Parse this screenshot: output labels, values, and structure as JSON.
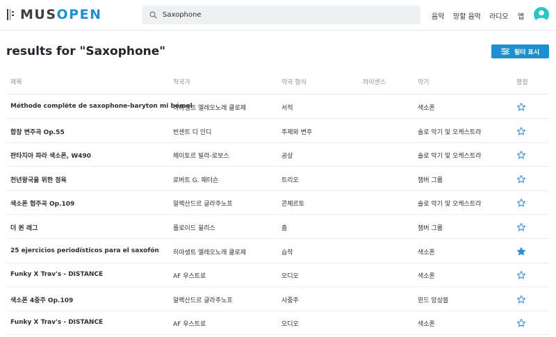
{
  "header": {
    "logo_text_a": "MUS",
    "logo_text_b": "OPEN",
    "search_value": "Saxophone",
    "nav": [
      "음악",
      "망할 음악",
      "라디오",
      "앱"
    ]
  },
  "page": {
    "title": "results for \"Saxophone\"",
    "filter_label": "필터 표시"
  },
  "table": {
    "columns": [
      "제목",
      "작곡가",
      "악곡 형식",
      "라이센스",
      "악기",
      "평점"
    ],
    "rows": [
      {
        "title": "Méthode complète de saxophone-baryton mi bémol",
        "composer": "히아생트 엘레오노레 클로제",
        "form": "서적",
        "license": "",
        "instrument": "색소폰",
        "favorited": false
      },
      {
        "title": "합창 변주곡 Op.55",
        "composer": "빈센트 디 인디",
        "form": "주제와 변주",
        "license": "",
        "instrument": "솔로 악기 및 오케스트라",
        "favorited": false
      },
      {
        "title": "판타지아 파라 색소폰, W490",
        "composer": "헤이토르 빌라-로보스",
        "form": "공상",
        "license": "",
        "instrument": "솔로 악기 및 오케스트라",
        "favorited": false
      },
      {
        "title": "천년왕국을 위한 정육",
        "composer": "로버트 G. 패터슨",
        "form": "트리오",
        "license": "",
        "instrument": "챔버 그룹",
        "favorited": false
      },
      {
        "title": "색소폰 협주곡 Op.109",
        "composer": "알렉산드르 글라주노프",
        "form": "콘체르토",
        "license": "",
        "instrument": "솔로 악기 및 오케스트라",
        "favorited": false
      },
      {
        "title": "더 퀸 래그",
        "composer": "플로이드 윌리스",
        "form": "춤",
        "license": "",
        "instrument": "챔버 그룹",
        "favorited": false
      },
      {
        "title": "25 ejercicios periodísticos para el saxofón",
        "composer": "히아생트 엘레오노레 클로제",
        "form": "습작",
        "license": "",
        "instrument": "색소폰",
        "favorited": true
      },
      {
        "title": "Funky X Trav's - DISTANCE",
        "composer": "AF 우스트로",
        "form": "오디오",
        "license": "",
        "instrument": "색소폰",
        "favorited": false
      },
      {
        "title": "색소폰 4중주 Op.109",
        "composer": "알렉산드르 글라주노프",
        "form": "사중주",
        "license": "",
        "instrument": "윈드 앙상블",
        "favorited": false
      },
      {
        "title": "Funky X Trav's - DISTANCE",
        "composer": "AF 우스트로",
        "form": "오디오",
        "license": "",
        "instrument": "색소폰",
        "favorited": false
      }
    ]
  },
  "colors": {
    "brand_blue": "#1e8fd1",
    "star_blue": "#2b8fd6",
    "avatar_teal": "#2cc4c4"
  },
  "icons": [
    "logo-icon",
    "search-icon",
    "avatar-icon",
    "filter-icon",
    "star-icon"
  ]
}
